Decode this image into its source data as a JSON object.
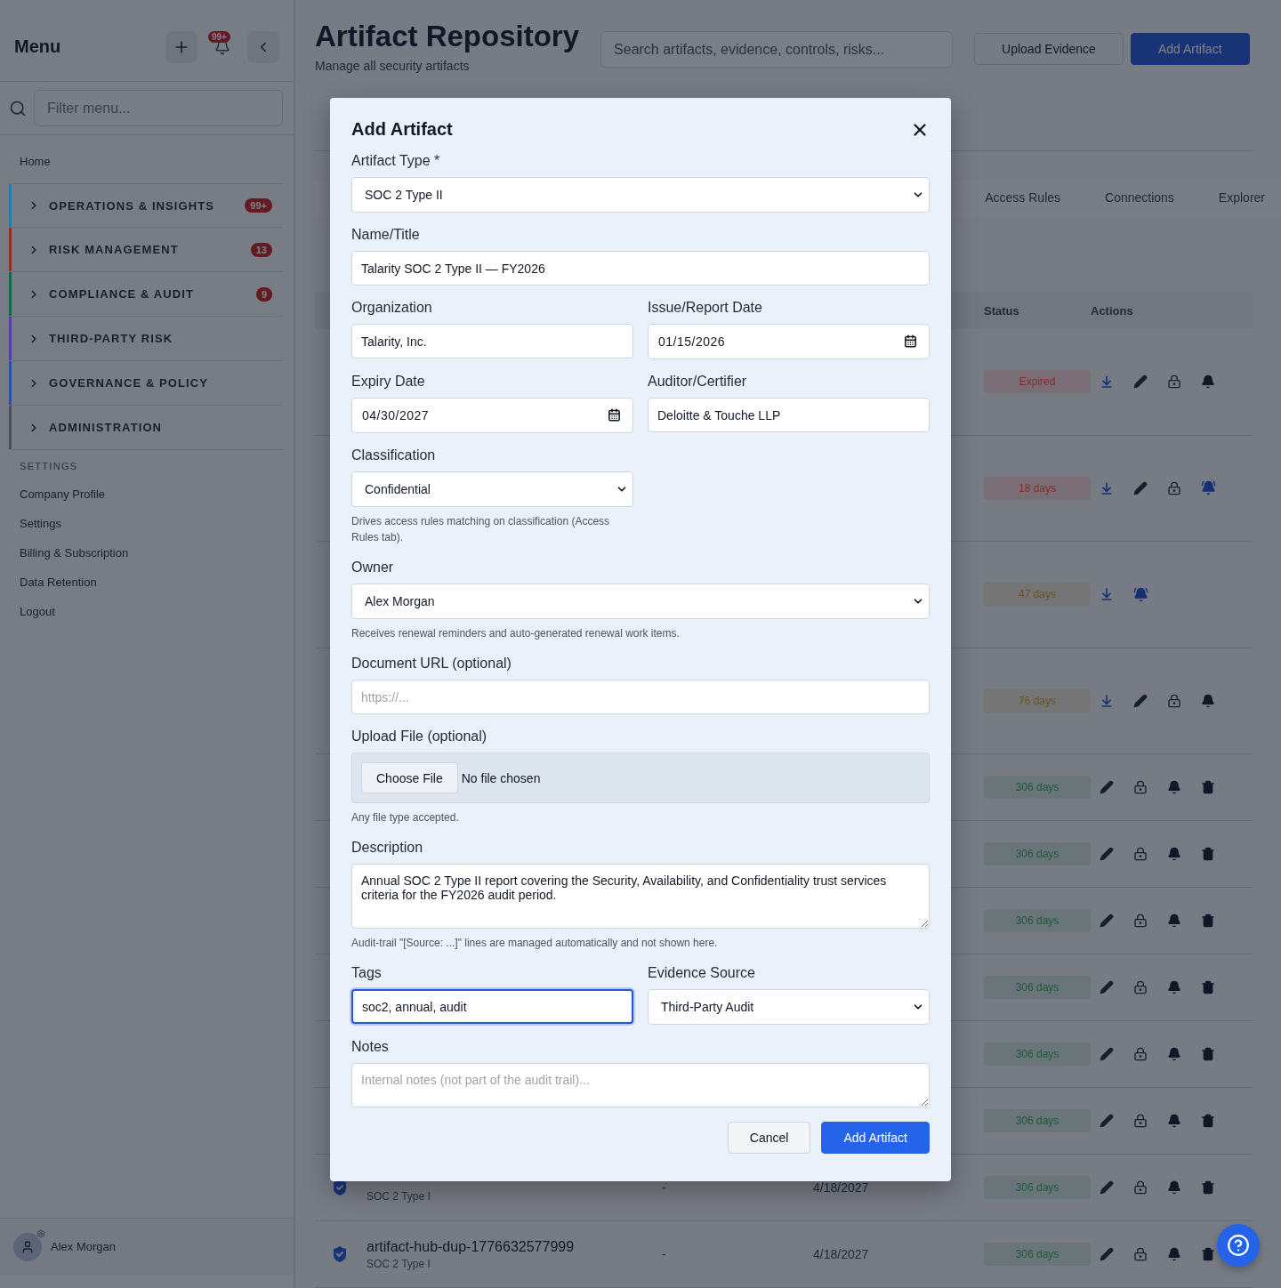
{
  "sidebar": {
    "title": "Menu",
    "notification_count": "99+",
    "filter": {
      "placeholder": "Filter menu..."
    },
    "home": "Home",
    "groups": [
      {
        "label": "OPERATIONS & INSIGHTS",
        "badge": "99+",
        "color": "#217fa3",
        "expanded": false
      },
      {
        "label": "RISK MANAGEMENT",
        "badge": "13",
        "color": "#9e2a2a",
        "expanded": false
      },
      {
        "label": "COMPLIANCE & AUDIT",
        "badge": "9",
        "color": "#126b4c",
        "expanded": false
      },
      {
        "label": "THIRD-PARTY RISK",
        "color": "#5b3ca6",
        "expanded": false
      },
      {
        "label": "GOVERNANCE & POLICY",
        "color": "#2d4ea6",
        "expanded": false
      },
      {
        "label": "ADMINISTRATION",
        "color": "#4a4f57",
        "expanded": false
      }
    ],
    "settings_heading": "SETTINGS",
    "settings_items": [
      "Company Profile",
      "Settings",
      "Billing & Subscription",
      "Data Retention",
      "Logout"
    ],
    "user": {
      "name": "Alex Morgan"
    }
  },
  "header": {
    "title": "Artifact Repository",
    "subtitle": "Manage all security artifacts",
    "search": {
      "placeholder": "Search artifacts, evidence, controls, risks..."
    },
    "buttons": [
      {
        "label": "Upload Evidence",
        "kind": "secondary"
      },
      {
        "label": "Add Artifact",
        "kind": "primary"
      }
    ]
  },
  "tabs": [
    {
      "label": "Access Rules",
      "selected": false
    },
    {
      "label": "Connections",
      "selected": false
    },
    {
      "label": "Explorer",
      "selected": false
    }
  ],
  "table": {
    "columns": [
      "Status",
      "Actions"
    ],
    "rows": [
      {
        "status": {
          "label": "Expired",
          "color": "#8b2a2a"
        },
        "actions": [
          {
            "kind": "download"
          },
          {
            "kind": "edit"
          },
          {
            "kind": "lock"
          },
          {
            "kind": "bell",
            "active": false
          }
        ]
      },
      {
        "status": {
          "label": "18 days",
          "color": "#8b2a2a"
        },
        "actions": [
          {
            "kind": "download"
          },
          {
            "kind": "edit"
          },
          {
            "kind": "lock"
          },
          {
            "kind": "bell",
            "active": true
          }
        ]
      },
      {
        "status": {
          "label": "47 days",
          "color": "#6b5420"
        },
        "actions": [
          {
            "kind": "download"
          },
          {
            "kind": "bell",
            "active": true
          }
        ]
      },
      {
        "status": {
          "label": "76 days",
          "color": "#6b5420"
        },
        "actions": [
          {
            "kind": "download"
          },
          {
            "kind": "edit"
          },
          {
            "kind": "lock"
          },
          {
            "kind": "bell",
            "active": false
          }
        ]
      },
      {
        "status": {
          "label": "306 days",
          "color": "#1f5a3a"
        },
        "actions": [
          {
            "kind": "edit"
          },
          {
            "kind": "lock"
          },
          {
            "kind": "bell",
            "active": false
          },
          {
            "kind": "trash"
          }
        ]
      },
      {
        "status": {
          "label": "306 days",
          "color": "#1f5a3a"
        },
        "actions": [
          {
            "kind": "edit"
          },
          {
            "kind": "lock"
          },
          {
            "kind": "bell",
            "active": false
          },
          {
            "kind": "trash"
          }
        ]
      },
      {
        "status": {
          "label": "306 days",
          "color": "#1f5a3a"
        },
        "actions": [
          {
            "kind": "edit"
          },
          {
            "kind": "lock"
          },
          {
            "kind": "bell",
            "active": false
          },
          {
            "kind": "trash"
          }
        ]
      },
      {
        "status": {
          "label": "306 days",
          "color": "#1f5a3a"
        },
        "actions": [
          {
            "kind": "edit"
          },
          {
            "kind": "lock"
          },
          {
            "kind": "bell",
            "active": false
          },
          {
            "kind": "trash"
          }
        ]
      },
      {
        "status": {
          "label": "306 days",
          "color": "#1f5a3a"
        },
        "actions": [
          {
            "kind": "edit"
          },
          {
            "kind": "lock"
          },
          {
            "kind": "bell",
            "active": false
          },
          {
            "kind": "trash"
          }
        ]
      },
      {
        "status": {
          "label": "306 days",
          "color": "#1f5a3a"
        },
        "actions": [
          {
            "kind": "edit"
          },
          {
            "kind": "lock"
          },
          {
            "kind": "bell",
            "active": false
          },
          {
            "kind": "trash"
          }
        ]
      },
      {
        "type": "SOC 2 Type I",
        "owner": "-",
        "date": "4/18/2027",
        "status": {
          "label": "306 days",
          "color": "#1f5a3a"
        },
        "actions": [
          {
            "kind": "edit"
          },
          {
            "kind": "lock"
          },
          {
            "kind": "bell",
            "active": false
          },
          {
            "kind": "trash"
          }
        ]
      },
      {
        "name": "artifact-hub-dup-1776632577999",
        "type": "SOC 2 Type I",
        "owner": "-",
        "date": "4/18/2027",
        "status": {
          "label": "306 days",
          "color": "#1f5a3a"
        },
        "actions": [
          {
            "kind": "edit"
          },
          {
            "kind": "lock"
          },
          {
            "kind": "bell",
            "active": false
          },
          {
            "kind": "trash"
          }
        ]
      }
    ]
  },
  "modal": {
    "title": "Add Artifact",
    "fields": [
      {
        "kind": "select",
        "label": "Artifact Type *",
        "value": "SOC 2 Type II",
        "wide": true,
        "focused": false
      },
      {
        "kind": "text",
        "label": "Name/Title",
        "value": "Talarity SOC 2 Type II — FY2026",
        "wide": true,
        "focused": false
      },
      {
        "kind": "text",
        "label": "Organization",
        "value": "Talarity, Inc.",
        "wide": false,
        "focused": false
      },
      {
        "kind": "date",
        "label": "Issue/Report Date",
        "value": "01/15/2026",
        "wide": false,
        "focused": false
      },
      {
        "kind": "date",
        "label": "Expiry Date",
        "value": "04/30/2027",
        "wide": false,
        "focused": false
      },
      {
        "kind": "text",
        "label": "Auditor/Certifier",
        "value": "Deloitte & Touche LLP",
        "wide": false,
        "focused": false
      },
      {
        "kind": "select",
        "label": "Classification",
        "value": "Confidential",
        "hint": "Drives access rules matching on classification (Access Rules tab).",
        "wide": false,
        "focused": false
      },
      {
        "kind": "select",
        "label": "Owner",
        "value": "Alex Morgan",
        "hint": "Receives renewal reminders and auto-generated renewal work items.",
        "wide": true,
        "focused": false
      },
      {
        "kind": "text",
        "label": "Document URL (optional)",
        "placeholder": "https://...",
        "wide": true,
        "focused": false
      },
      {
        "kind": "file",
        "label": "Upload File (optional)",
        "button": "Choose File",
        "status": "No file chosen",
        "hint": "Any file type accepted.",
        "wide": true,
        "focused": false
      },
      {
        "kind": "textarea",
        "label": "Description",
        "value": "Annual SOC 2 Type II report covering the Security, Availability, and Confidentiality trust services criteria for the FY2026 audit period.",
        "hint": "Audit-trail \"[Source: ...]\" lines are managed automatically and not shown here.",
        "wide": true,
        "focused": false
      },
      {
        "kind": "text",
        "label": "Tags",
        "value": "soc2, annual, audit",
        "wide": false,
        "focused": true
      },
      {
        "kind": "select",
        "label": "Evidence Source",
        "value": "Third-Party Audit",
        "wide": false,
        "focused": false
      },
      {
        "kind": "textarea",
        "label": "Notes",
        "placeholder": "Internal notes (not part of the audit trail)...",
        "wide": true,
        "focused": false
      }
    ],
    "buttons": [
      {
        "label": "Cancel",
        "kind": "secondary"
      },
      {
        "label": "Add Artifact",
        "kind": "primary"
      }
    ]
  }
}
